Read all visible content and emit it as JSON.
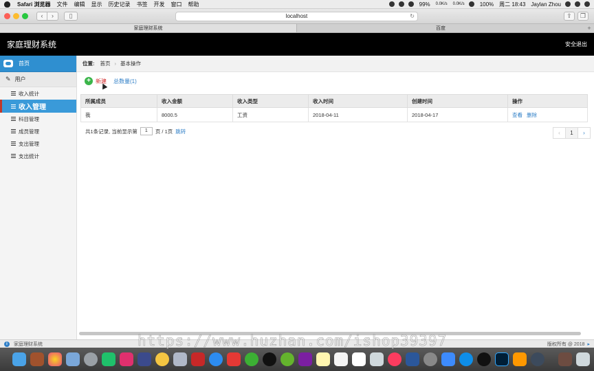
{
  "menubar": {
    "app": "Safari 浏览器",
    "items": [
      "文件",
      "编辑",
      "显示",
      "历史记录",
      "书签",
      "开发",
      "窗口",
      "帮助"
    ],
    "battery_pct": "99%",
    "net_up": "0.0K/s",
    "net_down": "0.0K/s",
    "battery2": "100%",
    "clock": "周二 18:43",
    "user": "Jaylan Zhou"
  },
  "browser": {
    "url": "localhost",
    "tabs": [
      "家庭理财系统",
      "百度"
    ]
  },
  "header": {
    "title": "家庭理财系统",
    "logout": "安全退出"
  },
  "sidebar": {
    "home": "首页",
    "user_section": "用户",
    "items": [
      {
        "label": "收入统计",
        "active": false
      },
      {
        "label": "收入管理",
        "active": true
      },
      {
        "label": "科目管理",
        "active": false
      },
      {
        "label": "成员管理",
        "active": false
      },
      {
        "label": "支出管理",
        "active": false
      },
      {
        "label": "支出统计",
        "active": false
      }
    ]
  },
  "breadcrumb": {
    "label": "位置:",
    "home": "首页",
    "current": "基本操作"
  },
  "actions": {
    "new": "新建",
    "count": "总数量(1)"
  },
  "table": {
    "headers": [
      "所属成员",
      "收入金额",
      "收入类型",
      "收入时间",
      "创建时间",
      "操作"
    ],
    "rows": [
      {
        "member": "我",
        "amount": "8000.5",
        "type": "工资",
        "income_time": "2018-04-11",
        "created": "2018-04-17",
        "view": "查看",
        "delete": "删除"
      }
    ]
  },
  "pager": {
    "summary_prefix": "共1条记录,  当前显示第",
    "page_value": "1",
    "summary_suffix": "页 / 1页",
    "jump": "跳转",
    "prev": "‹",
    "current": "1",
    "next": "›"
  },
  "statusbar": {
    "left": "家庭理财系统",
    "right": "版权所有 @ 2018"
  },
  "watermark": "https://www.huzhan.com/ishop39397",
  "colors": {
    "accent": "#3a9ad9",
    "header_bg": "#000000",
    "new_link": "#d32f2f",
    "link": "#2f7fc7"
  }
}
